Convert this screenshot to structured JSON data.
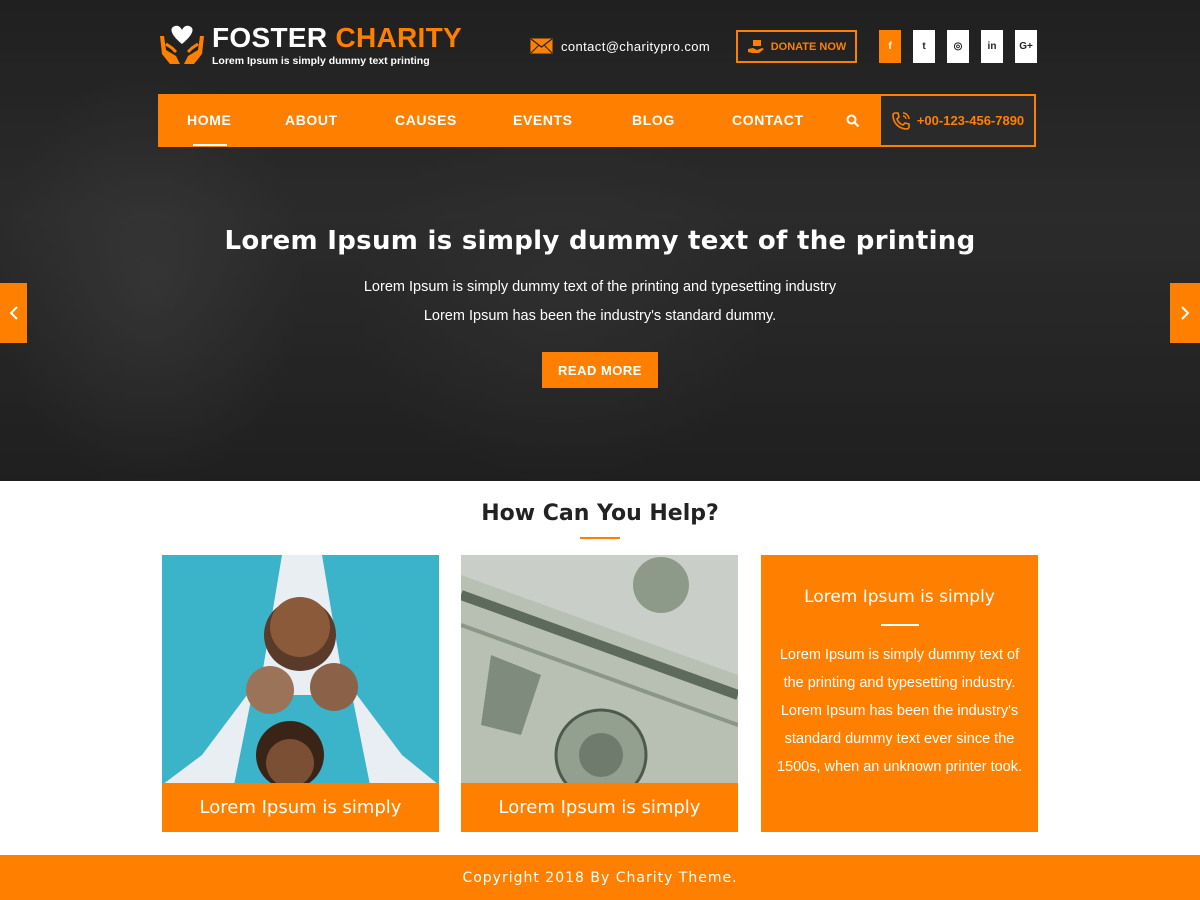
{
  "brand": {
    "name_part1": "FOSTER",
    "name_part2": "CHARITY",
    "tagline": "Lorem Ipsum is simply dummy text printing"
  },
  "header": {
    "email": "contact@charitypro.com",
    "donate_label": "DONATE NOW",
    "social": [
      {
        "icon": "facebook-icon",
        "glyph": "f"
      },
      {
        "icon": "twitter-icon",
        "glyph": "t"
      },
      {
        "icon": "instagram-icon",
        "glyph": "◎"
      },
      {
        "icon": "linkedin-icon",
        "glyph": "in"
      },
      {
        "icon": "google-plus-icon",
        "glyph": "G+"
      }
    ]
  },
  "nav": {
    "items": [
      {
        "label": "HOME",
        "active": true
      },
      {
        "label": "ABOUT"
      },
      {
        "label": "CAUSES"
      },
      {
        "label": "EVENTS"
      },
      {
        "label": "BLOG"
      },
      {
        "label": "CONTACT"
      }
    ],
    "search_icon": "search-icon",
    "phone": "+00-123-456-7890"
  },
  "hero": {
    "title": "Lorem Ipsum is simply dummy text of the printing",
    "line1": "Lorem Ipsum is simply dummy text of the printing and typesetting industry",
    "line2": "Lorem Ipsum has been the industry's standard dummy.",
    "button": "READ MORE"
  },
  "help": {
    "title": "How Can You Help?",
    "cards": [
      {
        "caption": "Lorem Ipsum is simply"
      },
      {
        "caption": "Lorem Ipsum is simply"
      },
      {
        "title": "Lorem Ipsum is simply",
        "text": "Lorem Ipsum is simply dummy text of the printing and typesetting industry. Lorem Ipsum has been the industry's standard dummy text ever since the 1500s, when an unknown printer took."
      }
    ]
  },
  "footer": {
    "copyright": "Copyright 2018 By Charity Theme."
  },
  "colors": {
    "accent": "#ff8000",
    "dark": "#2a2a2a",
    "white": "#ffffff"
  }
}
